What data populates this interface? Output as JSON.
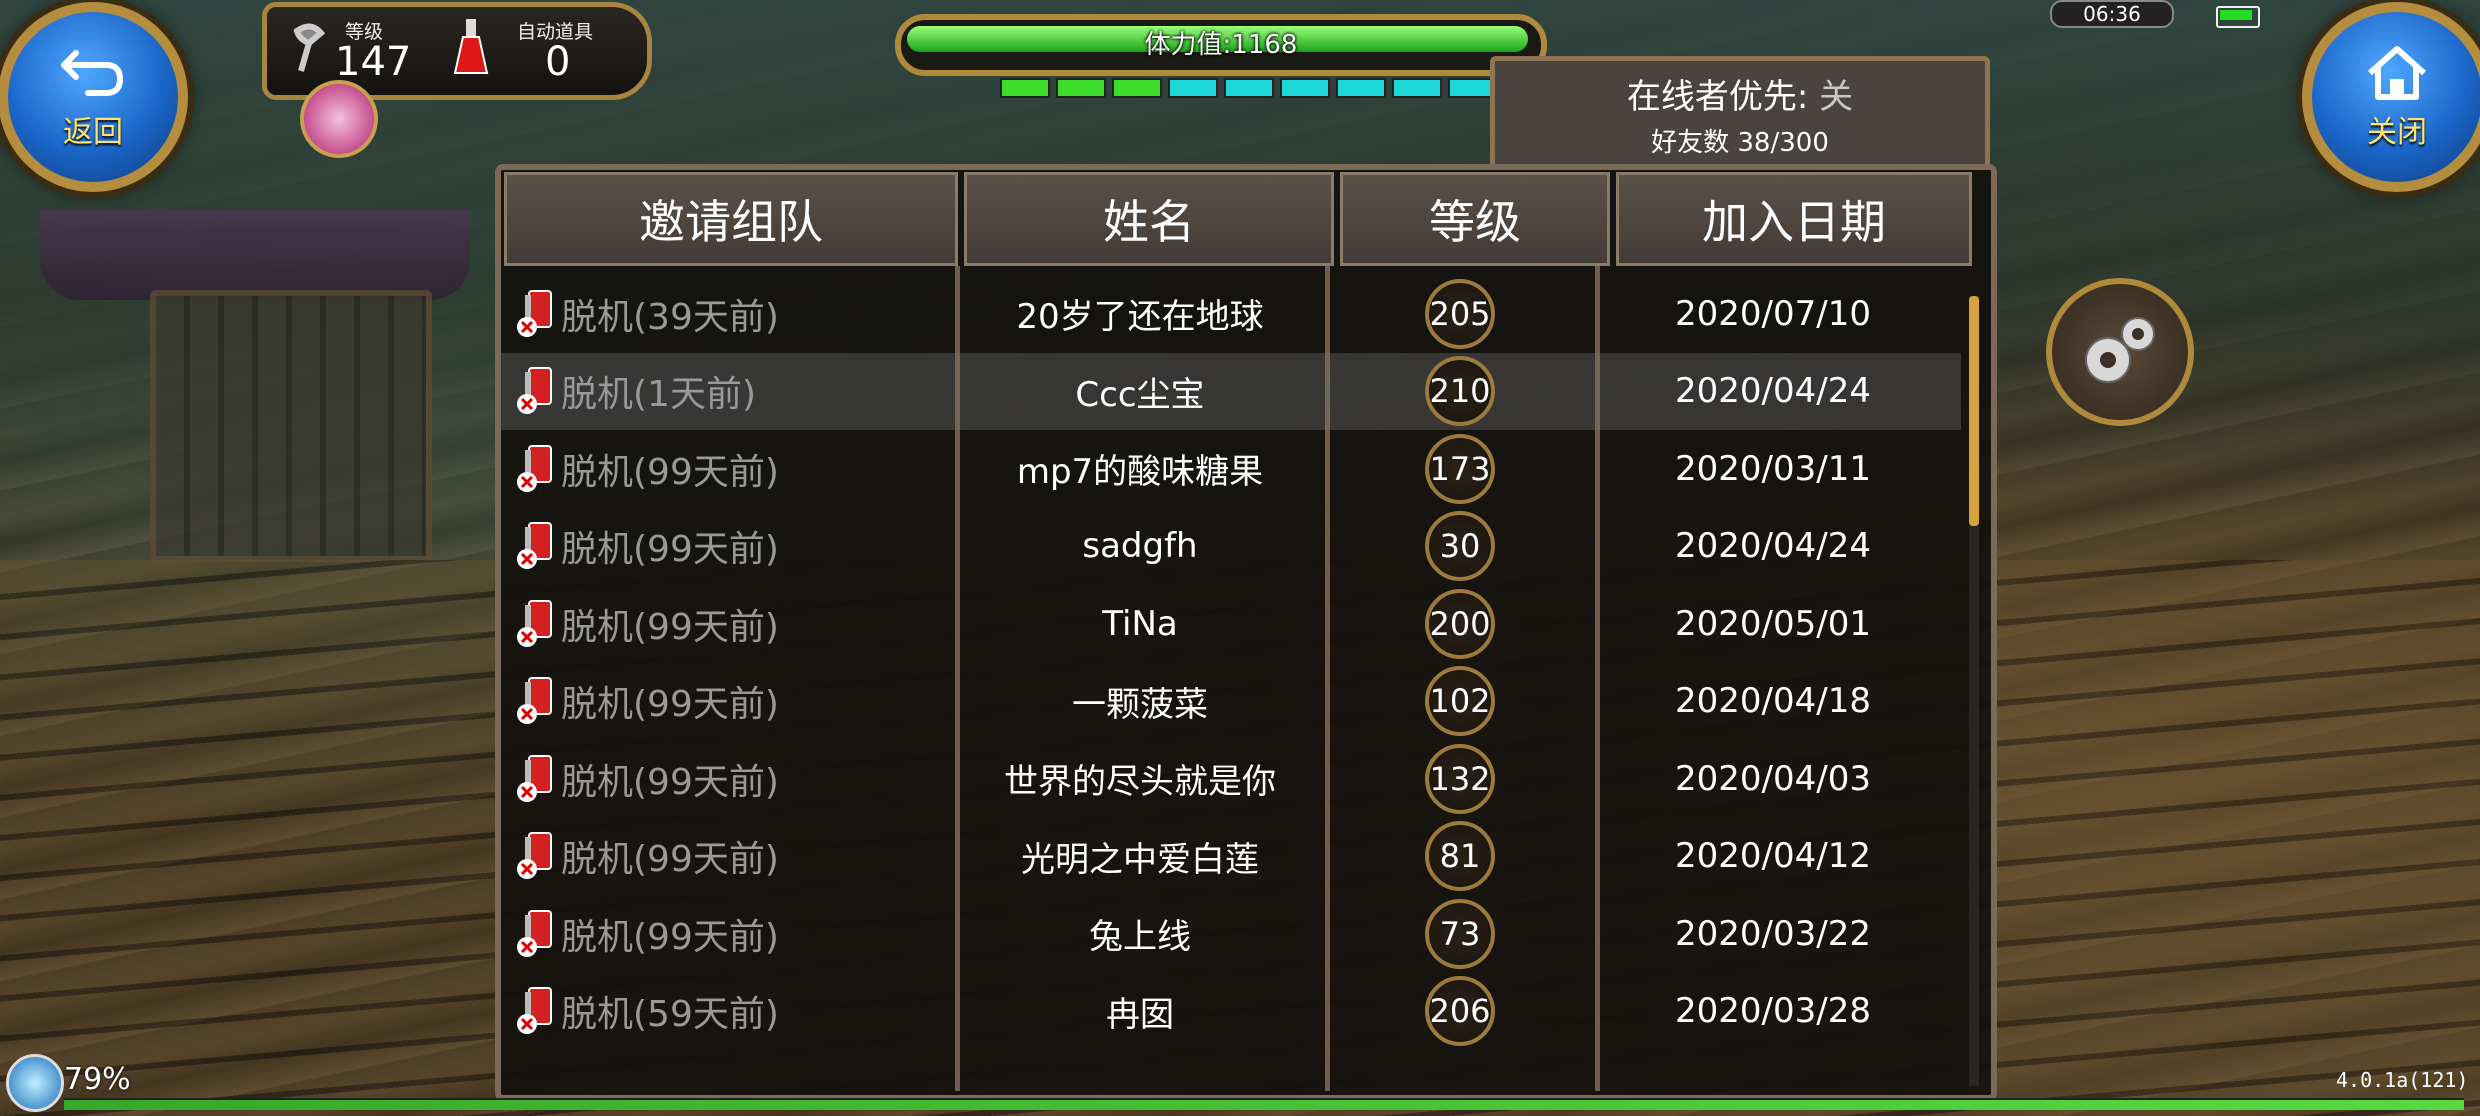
{
  "top_left": {
    "back_label": "返回",
    "level_label": "等级",
    "level_value": "147",
    "auto_item_label": "自动道具",
    "auto_item_value": "0"
  },
  "top_right": {
    "close_label": "关闭",
    "clock": "06:36"
  },
  "stamina": {
    "label": "体力值:1168",
    "fill_fraction": 0.97
  },
  "energy_segments": [
    {
      "color": "#3edc2a"
    },
    {
      "color": "#3edc2a"
    },
    {
      "color": "#3edc2a"
    },
    {
      "color": "#1ed7d7"
    },
    {
      "color": "#1ed7d7"
    },
    {
      "color": "#1ed7d7"
    },
    {
      "color": "#1ed7d7"
    },
    {
      "color": "#1ed7d7"
    },
    {
      "color": "#1ed7d7"
    }
  ],
  "online_box": {
    "priority_label": "在线者优先:",
    "priority_value": "关",
    "friend_count": "好友数 38/300"
  },
  "table": {
    "headers": {
      "invite": "邀请组队",
      "name": "姓名",
      "level": "等级",
      "date": "加入日期"
    },
    "rows": [
      {
        "status": "脱机(39天前)",
        "name": "20岁了还在地球",
        "level": "205",
        "date": "2020/07/10"
      },
      {
        "status": "脱机(1天前)",
        "name": "Ccc尘宝",
        "level": "210",
        "date": "2020/04/24"
      },
      {
        "status": "脱机(99天前)",
        "name": "mp7的酸味糖果",
        "level": "173",
        "date": "2020/03/11"
      },
      {
        "status": "脱机(99天前)",
        "name": "sadgfh",
        "level": "30",
        "date": "2020/04/24"
      },
      {
        "status": "脱机(99天前)",
        "name": "TiNa",
        "level": "200",
        "date": "2020/05/01"
      },
      {
        "status": "脱机(99天前)",
        "name": "一颗菠菜",
        "level": "102",
        "date": "2020/04/18"
      },
      {
        "status": "脱机(99天前)",
        "name": "世界的尽头就是你",
        "level": "132",
        "date": "2020/04/03"
      },
      {
        "status": "脱机(99天前)",
        "name": "光明之中爱白莲",
        "level": "81",
        "date": "2020/04/12"
      },
      {
        "status": "脱机(99天前)",
        "name": "兔上线",
        "level": "73",
        "date": "2020/03/22"
      },
      {
        "status": "脱机(59天前)",
        "name": "冉囡",
        "level": "206",
        "date": "2020/03/28"
      }
    ],
    "highlighted_row": 1
  },
  "bottom": {
    "sync_percent": "79%",
    "version": "4.0.1a(121)"
  },
  "icons": {
    "back": "back-arrow-icon",
    "close": "home-icon",
    "settings": "gears-icon",
    "offline": "offline-phone-icon"
  }
}
